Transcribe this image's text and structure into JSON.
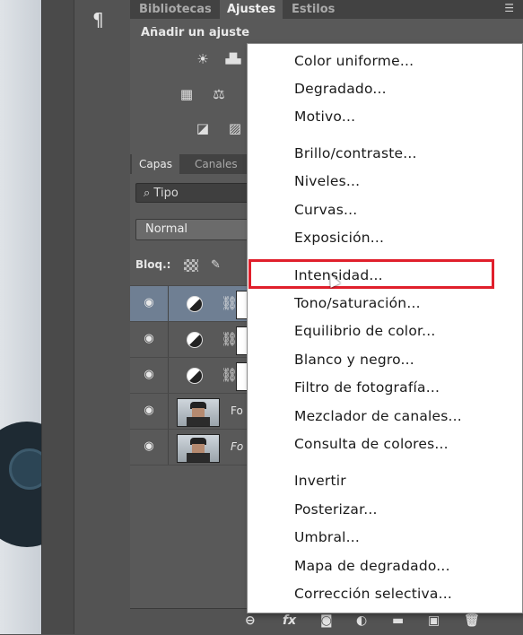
{
  "tool_strip": {
    "paragraph_symbol": "¶"
  },
  "top_tabs": [
    {
      "label": "Bibliotecas"
    },
    {
      "label": "Ajustes"
    },
    {
      "label": "Estilos"
    }
  ],
  "adjustments": {
    "title": "Añadir un ajuste",
    "icons": [
      "brightness-icon",
      "levels-icon",
      "gradient-map-icon",
      "balance-icon",
      "curves-icon",
      "photo-filter-icon"
    ]
  },
  "layers_panel": {
    "tabs": [
      {
        "label": "Capas"
      },
      {
        "label": "Canales"
      }
    ],
    "filter_label": "Tipo",
    "blend_mode": "Normal",
    "lock_label": "Bloq.:",
    "layers": [
      {
        "type": "adjustment",
        "selected": true
      },
      {
        "type": "adjustment",
        "selected": false
      },
      {
        "type": "adjustment",
        "selected": false
      },
      {
        "type": "photo",
        "name": "Fo",
        "selected": false
      },
      {
        "type": "photo",
        "name": "Fo",
        "selected": false
      }
    ],
    "bottom_icons": [
      "link-icon",
      "fx-icon",
      "mask-icon",
      "adjustment-layer-icon",
      "folder-icon",
      "new-layer-icon",
      "trash-icon"
    ],
    "fx_label": "fx"
  },
  "menu": {
    "items": [
      "Color uniforme...",
      "Degradado...",
      "Motivo...",
      "Brillo/contraste...",
      "Niveles...",
      "Curvas...",
      "Exposición...",
      "Intensidad...",
      "Tono/saturación...",
      "Equilibrio de color...",
      "Blanco y negro...",
      "Filtro de fotografía...",
      "Mezclador de canales...",
      "Consulta de colores...",
      "Invertir",
      "Posterizar...",
      "Umbral...",
      "Mapa de degradado...",
      "Corrección selectiva..."
    ],
    "highlighted_item": "Intensidad...",
    "highlight_color": "#e01f2b"
  }
}
